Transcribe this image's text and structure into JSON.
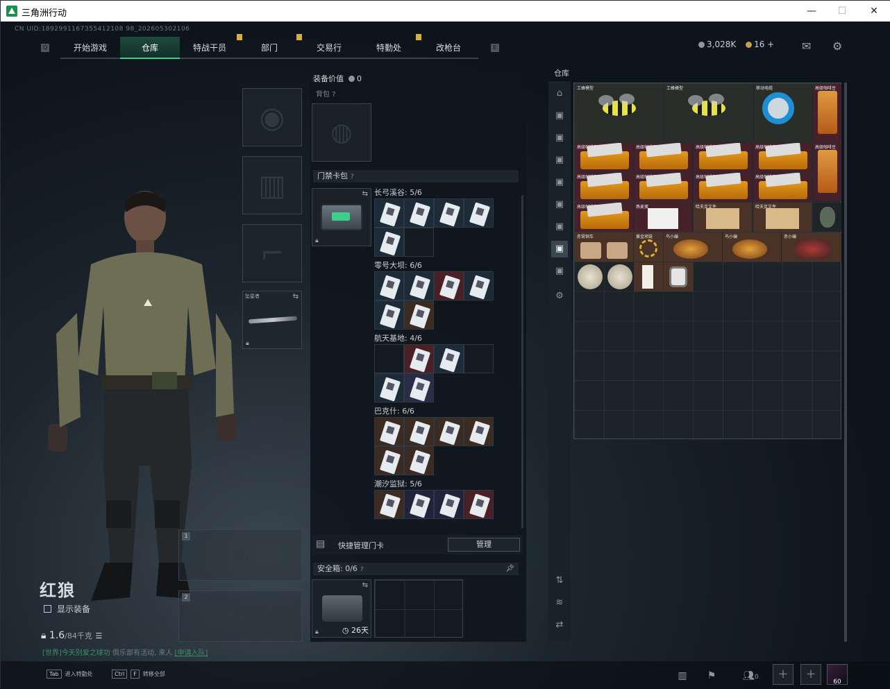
{
  "window": {
    "title": "三角洲行动",
    "minimize": "—",
    "maximize": "☐",
    "close": "✕"
  },
  "uid": "CN UID:1892991167355412108 98_202605302106",
  "nav": {
    "tabs": [
      {
        "label": "开始游戏",
        "active": false,
        "badge": false
      },
      {
        "label": "仓库",
        "active": true,
        "badge": false
      },
      {
        "label": "特战干员",
        "active": false,
        "badge": true
      },
      {
        "label": "部门",
        "active": false,
        "badge": true
      },
      {
        "label": "交易行",
        "active": false,
        "badge": false
      },
      {
        "label": "特勤处",
        "active": false,
        "badge": true
      },
      {
        "label": "改枪台",
        "active": false,
        "badge": false
      }
    ],
    "left_key": "Q",
    "right_key": "E"
  },
  "currency": {
    "havoc": "3,028K",
    "bonds": "16",
    "add": "+"
  },
  "character": {
    "name": "红狼",
    "show_equipment": "显示装备",
    "weight": "1.6",
    "weight_max": "/84千克",
    "recruit_prefix": "[世界]",
    "recruit_text": "今天别爱之球功",
    "recruit_mid": "俱乐部有活动, 来人",
    "recruit_link": "[申请入队]",
    "melee_label": "坠星者",
    "weapon_slot1": "1",
    "weapon_slot2": "2"
  },
  "center": {
    "equip_value_label": "装备价值",
    "equip_value": "0",
    "backpack_label": "背包",
    "keycard_label": "门禁卡包",
    "groups": [
      {
        "name": "长弓溪谷: 5/6"
      },
      {
        "name": "零号大坝: 6/6"
      },
      {
        "name": "航天基地: 4/6"
      },
      {
        "name": "巴克什: 6/6"
      },
      {
        "name": "潮汐监狱: 5/6"
      }
    ],
    "quick_manage": "快捷管理门卡",
    "manage_btn": "管理",
    "safebox_label": "安全箱: 0/6",
    "safebox_days": "26天"
  },
  "warehouse": {
    "title": "仓库",
    "items": {
      "bee": "工蜂模型",
      "reel": "移动电缆",
      "coffee": "高级咖啡豆",
      "tea": "高级咖啡豆",
      "anti": "燕麦蛋",
      "doc": "哈夫克文件",
      "toy": "赤霄铜车",
      "chain": "黄金项链",
      "dragon": "鸟小编",
      "mk": "赤小编"
    }
  },
  "footer": {
    "tab_key": "Tab",
    "tab_label": "进入特勤处",
    "ctrl_key": "Ctrl",
    "f_key": "F",
    "ctrl_label": "转移全部",
    "team_count": "0",
    "avatar_level": "60"
  }
}
